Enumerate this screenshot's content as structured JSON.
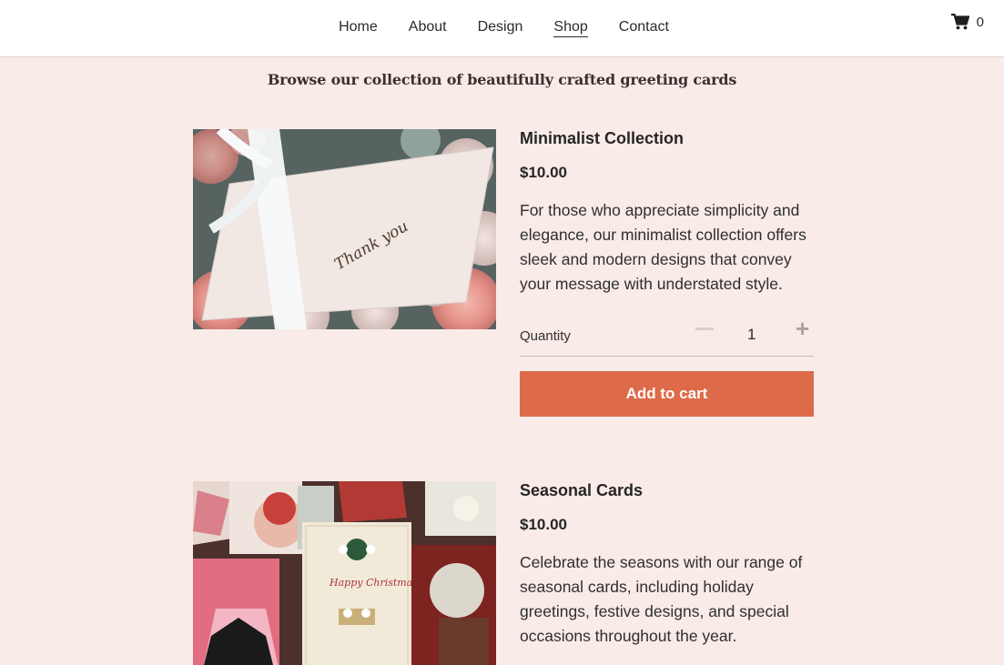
{
  "nav": {
    "items": [
      {
        "label": "Home"
      },
      {
        "label": "About"
      },
      {
        "label": "Design"
      },
      {
        "label": "Shop",
        "active": true
      },
      {
        "label": "Contact"
      }
    ],
    "cart_count": "0",
    "cart_icon": "shopping-cart-icon"
  },
  "tagline": "Browse our collection of beautifully crafted greeting cards",
  "products": [
    {
      "title": "Minimalist Collection",
      "price": "$10.00",
      "description": "For those who appreciate simplicity and elegance, our minimalist collection offers sleek and modern designs that convey your message with understated style.",
      "quantity_label": "Quantity",
      "quantity": "1",
      "add_label": "Add to cart",
      "image_text": "Thank you"
    },
    {
      "title": "Seasonal Cards",
      "price": "$10.00",
      "description": "Celebrate the seasons with our range of seasonal cards, including holiday greetings, festive designs, and special occasions throughout the year.",
      "image_text": "Happy Christmas to You"
    }
  ],
  "colors": {
    "background": "#f9ebe7",
    "accent": "#dd6b4a",
    "header": "#ffffff"
  }
}
